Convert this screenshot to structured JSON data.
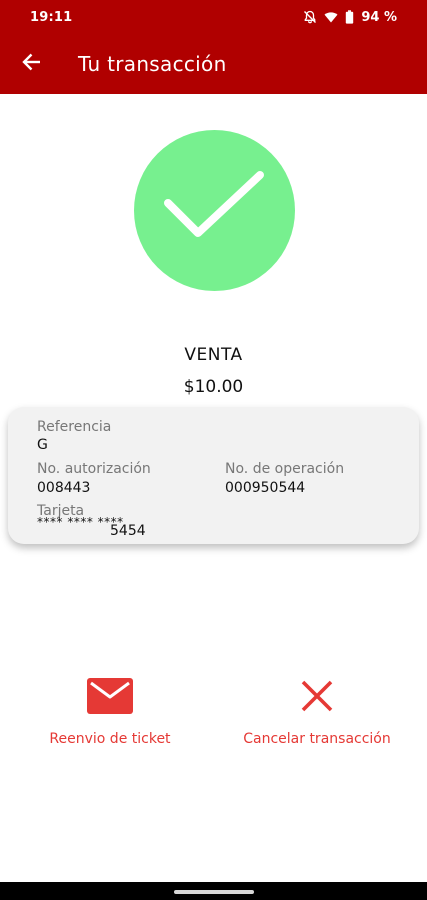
{
  "status_bar": {
    "time": "19:11",
    "battery": "94 %",
    "icons": [
      "bell-off-icon",
      "wifi-icon",
      "battery-icon"
    ]
  },
  "header": {
    "title": "Tu transacción",
    "back_icon": "arrow-back-icon",
    "background": "#b00000"
  },
  "result": {
    "icon": "check-icon",
    "circle_color": "#77f08f",
    "type": "VENTA",
    "amount": "$10.00"
  },
  "details": {
    "reference_label": "Referencia",
    "reference_value": "G",
    "auth_label": "No. autorización",
    "auth_value": "008443",
    "operation_label": "No. de operación",
    "operation_value": "000950544",
    "card_label": "Tarjeta",
    "card_mask": "**** **** ****",
    "card_last4": "5454"
  },
  "actions": {
    "resend_label": "Reenvio de ticket",
    "resend_icon": "mail-icon",
    "cancel_label": "Cancelar transacción",
    "cancel_icon": "close-icon",
    "accent_color": "#e53935"
  }
}
